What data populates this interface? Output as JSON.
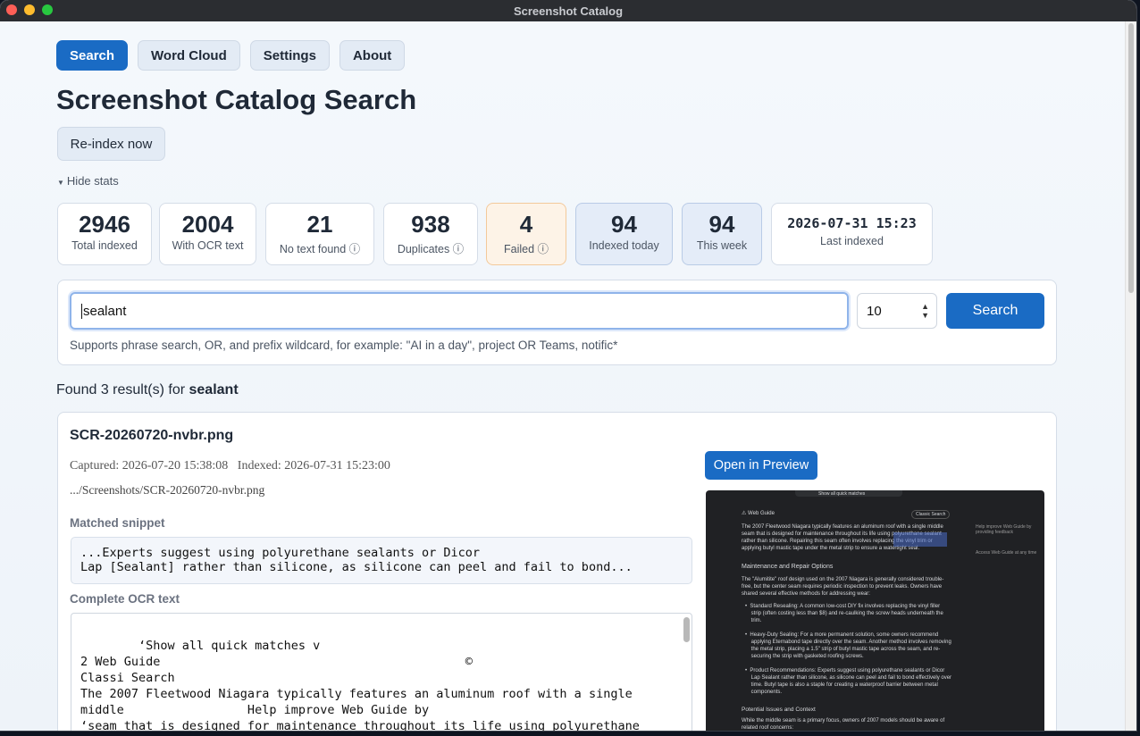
{
  "window": {
    "title": "Screenshot Catalog"
  },
  "tabs": [
    {
      "label": "Search",
      "active": true
    },
    {
      "label": "Word Cloud",
      "active": false
    },
    {
      "label": "Settings",
      "active": false
    },
    {
      "label": "About",
      "active": false
    }
  ],
  "page_title": "Screenshot Catalog Search",
  "reindex_label": "Re-index now",
  "hide_stats_label": "Hide stats",
  "stats": [
    {
      "value": "2946",
      "label": "Total indexed"
    },
    {
      "value": "2004",
      "label": "With OCR text"
    },
    {
      "value": "21",
      "label": "No text found ⓘ"
    },
    {
      "value": "938",
      "label": "Duplicates ⓘ"
    },
    {
      "value": "4",
      "label": "Failed ⓘ"
    },
    {
      "value": "94",
      "label": "Indexed today"
    },
    {
      "value": "94",
      "label": "This week"
    },
    {
      "value": "2026-07-31 15:23",
      "label": "Last indexed"
    }
  ],
  "search": {
    "query": "sealant",
    "limit": "10",
    "button_label": "Search",
    "hint": "Supports phrase search, OR, and prefix wildcard, for example: \"AI in a day\", project OR Teams, notific*"
  },
  "results_summary": {
    "prefix": "Found 3 result(s) for ",
    "term": "sealant"
  },
  "result": {
    "filename": "SCR-20260720-nvbr.png",
    "meta": "Captured: 2026-07-20 15:38:08   Indexed: 2026-07-31 15:23:00",
    "path": ".../Screenshots/SCR-20260720-nvbr.png",
    "open_label": "Open in Preview",
    "snippet_heading": "Matched snippet",
    "snippet": "...Experts suggest using polyurethane sealants or Dicor\nLap [Sealant] rather than silicone, as silicone can peel and fail to bond...",
    "ocr_heading": "Complete OCR text",
    "ocr_text": "‘Show all quick matches v\n2 Web Guide                                          ©\nClassi Search\nThe 2007 Fleetwood Niagara typically features an aluminum roof with a single\nmiddle                 Help improve Web Guide by\n‘seam that is designed for maintenance throughout its life using polyurethane\nsealant                providing feedback"
  },
  "preview_image": {
    "top": "Show all quick matches",
    "header": "Web Guide",
    "classic": "Classic Search",
    "feedback": "Help improve Web Guide by\nproviding feedback",
    "access": "Access Web Guide at any time",
    "p1": "The 2007 Fleetwood Niagara typically features an aluminum roof with a single middle\nseam that is designed for maintenance throughout its life using polyurethane sealant\nrather than silicone. Repairing this seam often involves replacing the vinyl trim or\napplying butyl mastic tape under the metal strip to ensure a watertight seal.",
    "h2": "Maintenance and Repair Options",
    "p2": "The \"Alumitite\" roof design used on the 2007 Niagara is generally considered trouble-\nfree, but the center seam requires periodic inspection to prevent leaks. Owners have\nshared several effective methods for addressing wear:",
    "b1": "•  Standard Resealing: A common low-cost DIY fix involves replacing the vinyl filler\n    strip (often costing less than $8) and re-caulking the screw heads underneath the\n    trim.",
    "b2": "•  Heavy-Duty Sealing: For a more permanent solution, some owners recommend\n    applying Eternabond tape directly over the seam. Another method involves removing\n    the metal strip, placing a 1.5\" strip of butyl mastic tape across the seam, and re-\n    securing the strip with gasketed roofing screws.",
    "b3": "•  Product Recommendations: Experts suggest using polyurethane sealants or Dicor\n    Lap Sealant rather than silicone, as silicone can peel and fail to bond effectively over\n    time. Butyl tape is also a staple for creating a waterproof barrier between metal\n    components.",
    "h3": "Potential Issues and Context",
    "p3": "While the middle seam is a primary focus, owners of 2007 models should be aware of\nrelated roof concerns:"
  },
  "colors": {
    "accent": "#1a6bc4",
    "warn_bg": "#fdf3e7",
    "info_bg": "#e4ecf8"
  }
}
